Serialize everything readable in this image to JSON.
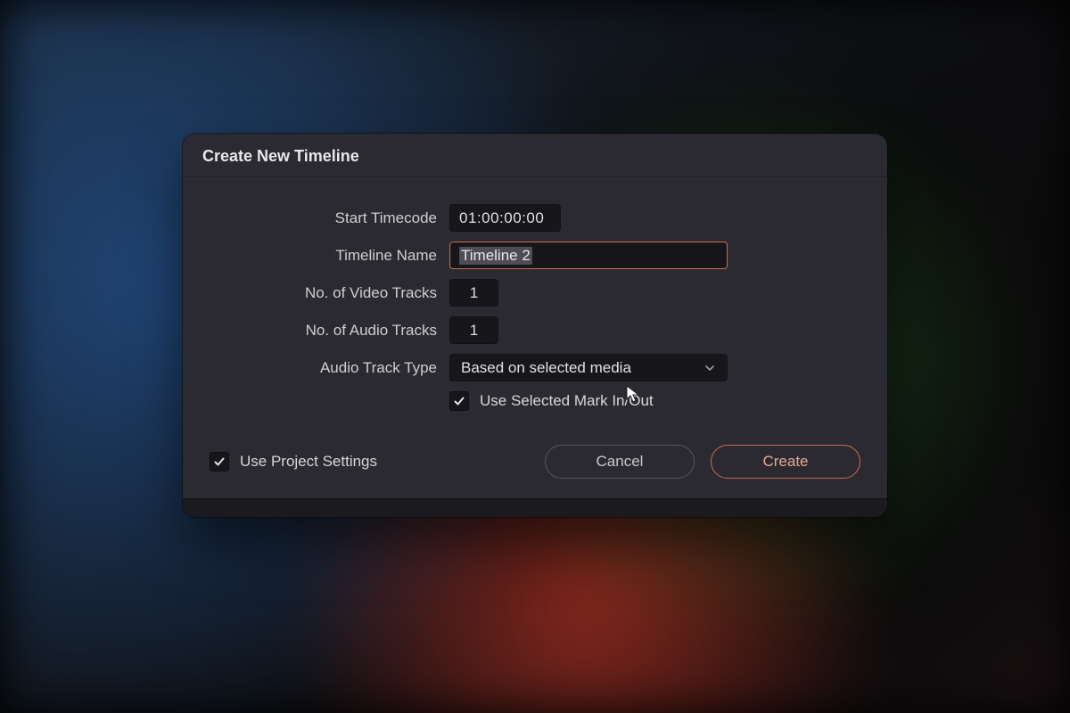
{
  "dialog": {
    "title": "Create New Timeline",
    "fields": {
      "start_timecode": {
        "label": "Start Timecode",
        "value": "01:00:00:00"
      },
      "timeline_name": {
        "label": "Timeline Name",
        "value": "Timeline 2"
      },
      "video_tracks": {
        "label": "No. of Video Tracks",
        "value": "1"
      },
      "audio_tracks": {
        "label": "No. of Audio Tracks",
        "value": "1"
      },
      "audio_track_type": {
        "label": "Audio Track Type",
        "value": "Based on selected media"
      }
    },
    "checkboxes": {
      "use_selected_mark": {
        "label": "Use Selected Mark In/Out",
        "checked": true
      },
      "use_project_settings": {
        "label": "Use Project Settings",
        "checked": true
      }
    },
    "buttons": {
      "cancel": "Cancel",
      "create": "Create"
    }
  }
}
